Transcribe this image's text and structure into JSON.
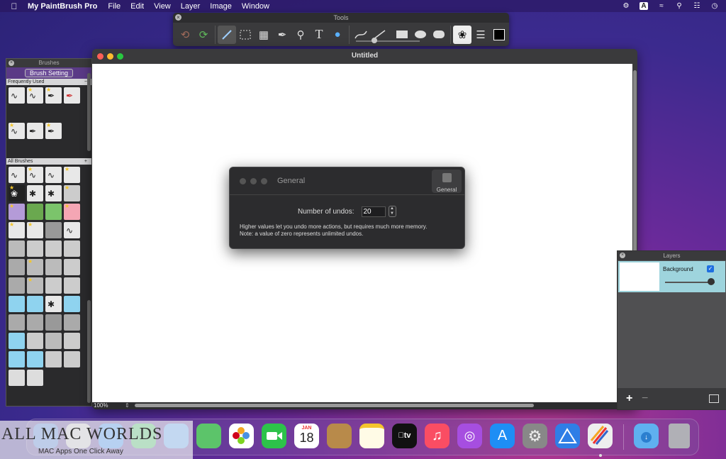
{
  "menubar": {
    "apple_icon": "apple-icon",
    "app_name": "My PaintBrush Pro",
    "items": [
      "File",
      "Edit",
      "View",
      "Layer",
      "Image",
      "Window"
    ],
    "status_icons": [
      "gear-icon",
      "input-source-icon",
      "wifi-icon",
      "search-icon",
      "control-center-icon",
      "clock-icon"
    ],
    "input_letter": "A"
  },
  "tools": {
    "title": "Tools"
  },
  "brushes": {
    "title": "Brushes",
    "setting_button": "Brush Setting",
    "frequently_used": "Frequently Used",
    "all_brushes": "All Brushes"
  },
  "document": {
    "title": "Untitled",
    "zoom": "100%"
  },
  "general": {
    "title": "General",
    "tab_label": "General",
    "undo_label": "Number of undos:",
    "undo_value": "20",
    "note_line1": "Higher values let you undo more actions, but requires much more memory.",
    "note_line2": "Note: a value of zero represents unlimited undos."
  },
  "layers": {
    "title": "Layers",
    "layer_name": "Background",
    "layer_visible": true,
    "opacity": 1.0
  },
  "dock": {
    "calendar_month": "JAN",
    "calendar_day": "18",
    "tv_label": "tv"
  },
  "watermark": {
    "title": "ALL MAC WORLDS",
    "tagline": "MAC Apps One Click Away"
  },
  "colors": {
    "accent": "#1f6fe0",
    "layer_selected": "#9ed4dd",
    "close": "#ff5f57",
    "minimize": "#febc2e",
    "zoom": "#28c840"
  }
}
